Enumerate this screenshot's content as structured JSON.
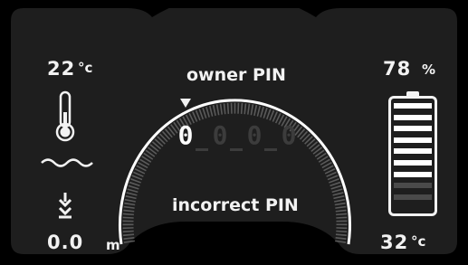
{
  "left": {
    "temperature_value": "22",
    "temperature_unit": "°c",
    "depth_value": "0.0",
    "depth_unit": "m"
  },
  "center": {
    "title": "owner PIN",
    "pin_digits": [
      "0",
      "0",
      "0",
      "0"
    ],
    "active_digit_index": 0,
    "status": "incorrect PIN"
  },
  "right": {
    "battery_value": "78",
    "battery_unit": "%",
    "battery_level": 0.78,
    "battery_segments": [
      true,
      true,
      true,
      true,
      true,
      true,
      true,
      false,
      false
    ],
    "water_temp_value": "32",
    "water_temp_unit": "°c"
  },
  "icons": {
    "thermometer": "thermometer-icon",
    "waves": "water-waves-icon",
    "descent": "descent-arrow-icon",
    "battery": "battery-icon",
    "cursor": "cursor-down-triangle-icon"
  },
  "colors": {
    "background": "#000000",
    "panel": "#1e1e1e",
    "text": "#f2f2f2",
    "inactive": "#3c3c3c",
    "gauge": "#ffffff"
  }
}
